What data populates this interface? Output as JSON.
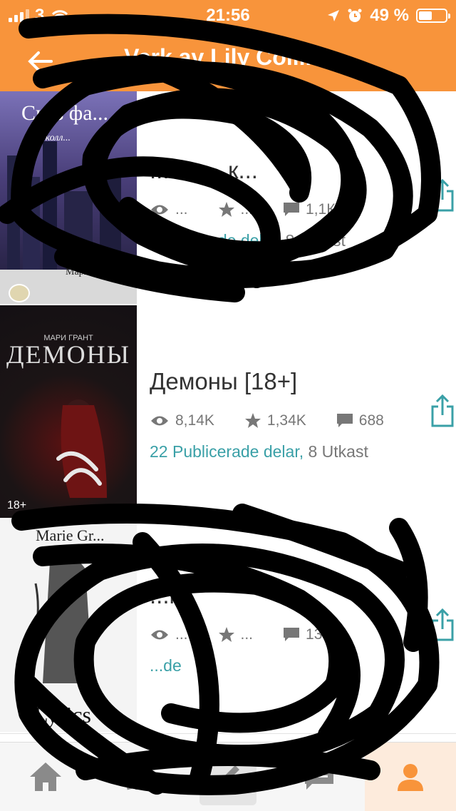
{
  "status": {
    "carrier": "3",
    "time": "21:56",
    "battery_percent": "49 %",
    "battery_level": 0.49
  },
  "header": {
    "title": "Verk av Lily Collins",
    "back_icon": "back-arrow-icon",
    "color": "#f8943b"
  },
  "books": [
    {
      "cover_title": "Сказ фа...",
      "cover_sub": "О колл...",
      "cover_author": "Мари Грант",
      "title": "... ... ... к...",
      "views": "...",
      "stars": "...",
      "comments": "1,1К",
      "published": "Publicerade delar,",
      "drafts": "8 Utkast"
    },
    {
      "cover_author": "МАРИ ГРАНТ",
      "cover_title": "ДЕМОНЫ",
      "cover_badge": "18+",
      "title": "Демоны [18+]",
      "views": "8,14K",
      "stars": "1,34K",
      "comments": "688",
      "published": "22 Publicerade delar,",
      "drafts": "8 Utkast"
    },
    {
      "cover_author": "Marie Gr...",
      "cover_title": "Lyrics",
      "title": "...rs",
      "views": "...",
      "stars": "...",
      "comments": "13",
      "published": "...de",
      "drafts": ""
    }
  ],
  "accent": "#3aa0a7",
  "tabs": [
    {
      "name": "home",
      "icon": "home-icon"
    },
    {
      "name": "library",
      "icon": "library-icon"
    },
    {
      "name": "write",
      "icon": "pencil-icon"
    },
    {
      "name": "messages",
      "icon": "chat-icon"
    },
    {
      "name": "profile",
      "icon": "profile-icon",
      "active": true
    }
  ]
}
